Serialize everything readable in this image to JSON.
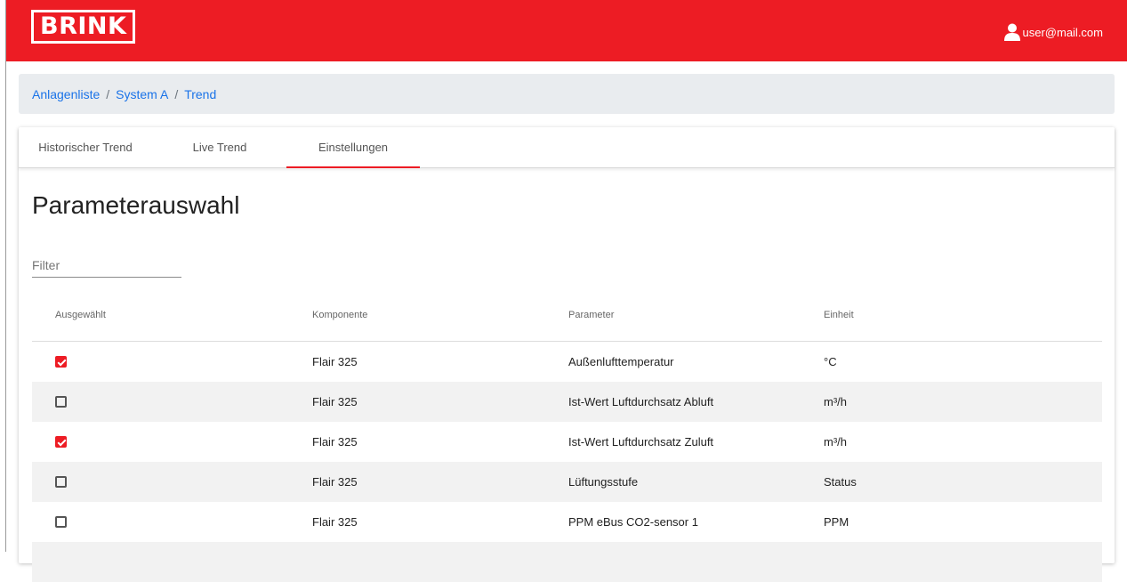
{
  "header": {
    "logo_text": "BRINK",
    "user_email": "user@mail.com",
    "brand_color": "#ed1c24"
  },
  "breadcrumb": {
    "items": [
      "Anlagenliste",
      "System A",
      "Trend"
    ],
    "separator": "/"
  },
  "tabs": [
    {
      "label": "Historischer Trend",
      "active": false
    },
    {
      "label": "Live Trend",
      "active": false
    },
    {
      "label": "Einstellungen",
      "active": true
    }
  ],
  "page_title": "Parameterauswahl",
  "filter": {
    "placeholder": "Filter",
    "value": ""
  },
  "table": {
    "columns": [
      "Ausgewählt",
      "Komponente",
      "Parameter",
      "Einheit"
    ],
    "rows": [
      {
        "selected": true,
        "component": "Flair 325",
        "parameter": "Außenlufttemperatur",
        "unit": "°C"
      },
      {
        "selected": false,
        "component": "Flair 325",
        "parameter": "Ist-Wert Luftdurchsatz Abluft",
        "unit": "m³/h"
      },
      {
        "selected": true,
        "component": "Flair 325",
        "parameter": "Ist-Wert Luftdurchsatz Zuluft",
        "unit": "m³/h"
      },
      {
        "selected": false,
        "component": "Flair 325",
        "parameter": "Lüftungsstufe",
        "unit": "Status"
      },
      {
        "selected": false,
        "component": "Flair 325",
        "parameter": "PPM eBus CO2-sensor 1",
        "unit": "PPM"
      }
    ]
  }
}
